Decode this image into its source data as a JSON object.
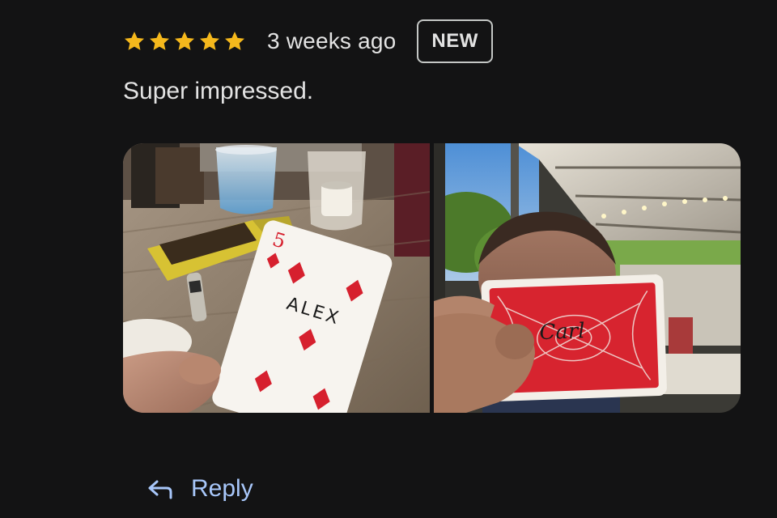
{
  "review": {
    "rating": 5,
    "rating_max": 5,
    "time_ago": "3 weeks ago",
    "badge": "NEW",
    "text": "Super impressed.",
    "star_color": "#f5b81c",
    "photos": [
      {
        "icon": "photo-playing-card-five-of-diamonds",
        "card_rank": "5",
        "card_name": "ALEX"
      },
      {
        "icon": "photo-person-holding-card-back",
        "card_name": "Carl"
      }
    ]
  },
  "actions": {
    "reply_label": "Reply",
    "reply_icon": "reply-arrow-icon",
    "accent_color": "#a8c7fa"
  }
}
